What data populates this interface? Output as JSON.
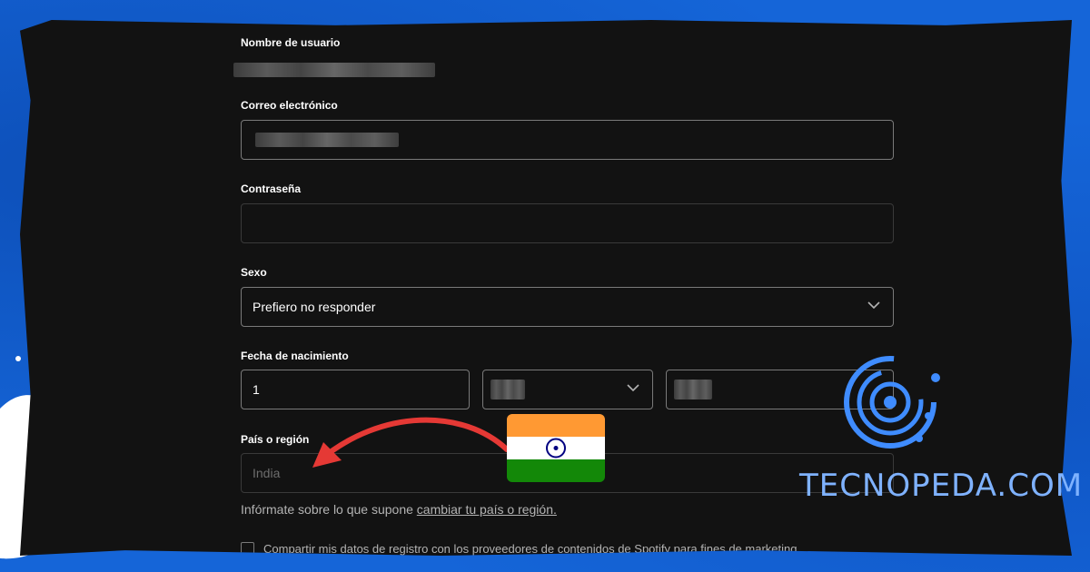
{
  "form": {
    "username_label": "Nombre de usuario",
    "email_label": "Correo electrónico",
    "password_label": "Contraseña",
    "gender_label": "Sexo",
    "gender_value": "Prefiero no responder",
    "birthdate_label": "Fecha de nacimiento",
    "birth_day_value": "1",
    "country_label": "País o región",
    "country_value": "India",
    "info_text": "Infórmate sobre lo que supone",
    "info_link": "cambiar tu país o región.",
    "share_data_text": "Compartir mis datos de registro con los proveedores de contenidos de Spotify para fines de marketing."
  },
  "overlay": {
    "brand": "TECNOPEDA.COM",
    "flag_country": "India",
    "arrow_color": "#e53935"
  },
  "colors": {
    "background": "#1565d8",
    "panel": "#121212",
    "field_border": "#7a7a7a"
  }
}
